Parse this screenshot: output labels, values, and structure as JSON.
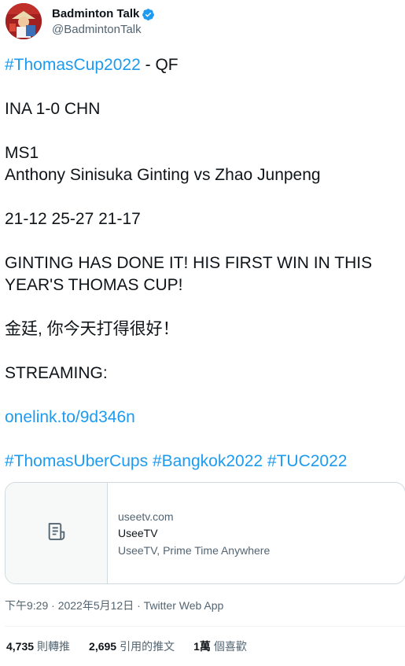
{
  "author": {
    "display_name": "Badminton Talk",
    "handle": "@BadmintonTalk",
    "verified": true
  },
  "tweet": {
    "lines": [
      {
        "parts": [
          {
            "text": "#ThomasCup2022",
            "link": true
          },
          {
            "text": " - QF",
            "link": false
          }
        ]
      },
      {
        "parts": [
          {
            "text": "INA 1-0 CHN",
            "link": false
          }
        ]
      },
      {
        "parts": [
          {
            "text": "MS1",
            "link": false
          }
        ]
      },
      {
        "parts": [
          {
            "text": "Anthony Sinisuka Ginting vs Zhao Junpeng",
            "link": false
          }
        ]
      },
      {
        "parts": [
          {
            "text": "21-12 25-27 21-17",
            "link": false
          }
        ]
      },
      {
        "parts": [
          {
            "text": "GINTING HAS DONE IT! HIS FIRST WIN IN THIS",
            "link": false
          }
        ]
      },
      {
        "parts": [
          {
            "text": "YEAR'S THOMAS CUP!",
            "link": false
          }
        ]
      },
      {
        "parts": [
          {
            "text": "金廷, 你今天打得很好！",
            "link": false
          }
        ]
      },
      {
        "parts": [
          {
            "text": "STREAMING:",
            "link": false
          }
        ]
      },
      {
        "parts": [
          {
            "text": "onelink.to/9d346n",
            "link": true
          }
        ]
      },
      {
        "parts": [
          {
            "text": "#ThomasUberCups",
            "link": true
          },
          {
            "text": " ",
            "link": false
          },
          {
            "text": "#Bangkok2022",
            "link": true
          },
          {
            "text": " ",
            "link": false
          },
          {
            "text": "#TUC2022",
            "link": true
          }
        ]
      }
    ]
  },
  "card": {
    "icon": "document-icon",
    "domain": "useetv.com",
    "title": "UseeTV",
    "description": "UseeTV, Prime Time Anywhere"
  },
  "meta": {
    "timestamp": "下午9:29 · 2022年5月12日",
    "separator": " · ",
    "source": "Twitter Web App"
  },
  "stats": {
    "retweets_count": "4,735",
    "retweets_label": "則轉推",
    "quotes_count": "2,695",
    "quotes_label": "引用的推文",
    "likes_count": "1萬",
    "likes_label": "個喜歡"
  },
  "colors": {
    "link": "#1d9bf0",
    "text": "#0f1419",
    "secondary": "#536471",
    "border": "#cfd9de"
  }
}
